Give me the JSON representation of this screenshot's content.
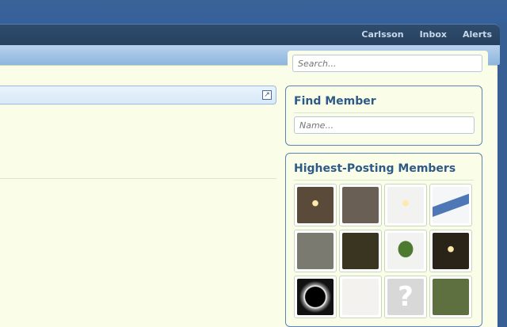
{
  "nav": {
    "links": [
      {
        "label": "Carlsson"
      },
      {
        "label": "Inbox"
      },
      {
        "label": "Alerts"
      }
    ]
  },
  "search": {
    "placeholder": "Search..."
  },
  "find_member": {
    "title": "Find Member",
    "placeholder": "Name..."
  },
  "highest_posting": {
    "title": "Highest-Posting Members",
    "avatars": [
      {
        "icon": "lamp-photo",
        "bg": "#5a4a3a"
      },
      {
        "icon": "people-photo",
        "bg": "#6a5f55"
      },
      {
        "icon": "lamp-photo",
        "bg": "#f2f2f0"
      },
      {
        "icon": "jet-photo",
        "bg": "#f4f6f8"
      },
      {
        "icon": "lantern-photo",
        "bg": "#7a7a70"
      },
      {
        "icon": "person-photo",
        "bg": "#3a3520"
      },
      {
        "icon": "hulk-photo",
        "bg": "#f2f2f0"
      },
      {
        "icon": "lamp-photo",
        "bg": "#2a2418"
      },
      {
        "icon": "eclipse-photo",
        "bg": "#111111"
      },
      {
        "icon": "cartoon-photo",
        "bg": "#f4f2ee"
      },
      {
        "icon": "question-icon",
        "bg": "#d8d8d8"
      },
      {
        "icon": "lantern-photo",
        "bg": "#5f7040"
      }
    ]
  }
}
